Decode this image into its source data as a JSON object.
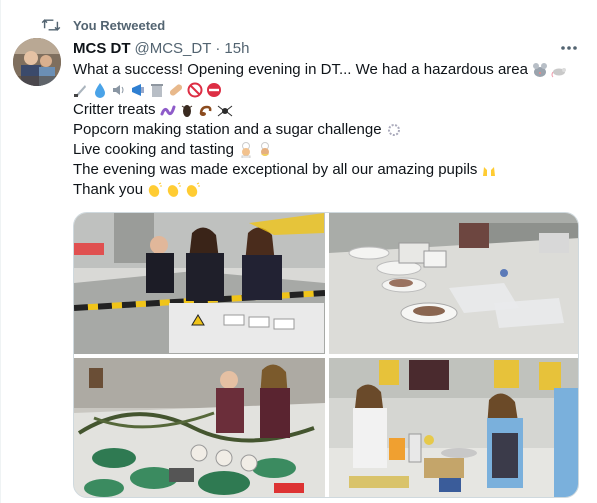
{
  "retweet": {
    "label": "You Retweeted"
  },
  "author": {
    "name": "MCS DT",
    "handle": "@MCS_DT",
    "separator": "·",
    "time": "15h"
  },
  "tweet": {
    "lines": [
      "What a success! Opening evening in DT... We had a hazardous area",
      "",
      "Critter treats",
      "Popcorn making station and a sugar challenge",
      "Live cooking and tasting",
      "The evening was made exceptional by all our amazing pupils",
      "Thank you"
    ]
  },
  "icons": {
    "retweet": "retweet-icon",
    "more": "more-options-icon",
    "line1_emoji": [
      "mouse-icon",
      "rat-icon"
    ],
    "line2_emoji": [
      "knife-icon",
      "droplet-icon",
      "speaker-icon",
      "megaphone-icon",
      "trash-bin-icon",
      "bandage-icon",
      "prohibited-icon",
      "no-entry-icon"
    ],
    "critter_emoji": [
      "worm-icon",
      "cockroach-icon",
      "scorpion-icon",
      "spider-icon"
    ],
    "sugar_emoji": [
      "sparkle-icon"
    ],
    "cooking_emoji": [
      "chef-icon",
      "chef-icon"
    ],
    "pupils_emoji": [
      "raised-hands-icon"
    ],
    "thanks_emoji": [
      "clapping-icon",
      "clapping-icon",
      "clapping-icon"
    ]
  },
  "colors": {
    "text": "#0f1419",
    "secondary": "#536471",
    "border": "#cfd9de"
  },
  "media": {
    "photos": [
      "photo-hazard-area",
      "photo-sugar-challenge",
      "photo-critter-table",
      "photo-live-cooking"
    ]
  }
}
